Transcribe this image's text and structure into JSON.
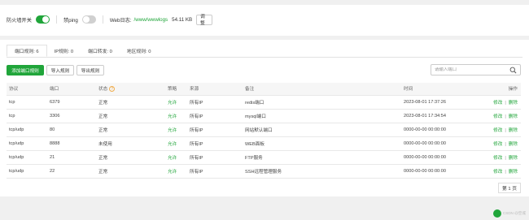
{
  "firewall_bar": {
    "firewall_label": "防火墙开关",
    "firewall_on": true,
    "ping_label": "禁ping",
    "ping_on": false,
    "weblog_label": "Web日志:",
    "weblog_path": "/www/wwwlogs",
    "weblog_size": "54.11 KB",
    "adjust_button": "调整"
  },
  "tabs": [
    {
      "label": "端口规则: 6",
      "active": true
    },
    {
      "label": "IP规则: 0",
      "active": false
    },
    {
      "label": "端口转发: 0",
      "active": false
    },
    {
      "label": "地区规则: 0",
      "active": false
    }
  ],
  "actions": {
    "add_rule": "添加端口规则",
    "import_rule": "导入规则",
    "export_rule": "导出规则"
  },
  "search": {
    "placeholder": "请输入端口",
    "icon": "search-icon"
  },
  "table": {
    "headers": {
      "protocol": "协议",
      "port": "端口",
      "status": "状态",
      "strategy": "策略",
      "source": "来源",
      "remark": "备注",
      "time": "时间",
      "ops": "操作"
    },
    "rows": [
      {
        "protocol": "tcp",
        "port": "6379",
        "status": "正常",
        "strategy": "允许",
        "source": "所有IP",
        "remark": "redis端口",
        "time": "2023-08-01 17:37:26",
        "edit": "修改",
        "delete": "删除"
      },
      {
        "protocol": "tcp",
        "port": "3306",
        "status": "正常",
        "strategy": "允许",
        "source": "所有IP",
        "remark": "mysql端口",
        "time": "2023-08-01 17:34:54",
        "edit": "修改",
        "delete": "删除"
      },
      {
        "protocol": "tcp/udp",
        "port": "80",
        "status": "正常",
        "strategy": "允许",
        "source": "所有IP",
        "remark": "网站默认端口",
        "time": "0000-00-00 00:00:00",
        "edit": "修改",
        "delete": "删除"
      },
      {
        "protocol": "tcp/udp",
        "port": "8888",
        "status": "未使用",
        "strategy": "允许",
        "source": "所有IP",
        "remark": "WEB面板",
        "time": "0000-00-00 00:00:00",
        "edit": "修改",
        "delete": "删除"
      },
      {
        "protocol": "tcp/udp",
        "port": "21",
        "status": "正常",
        "strategy": "允许",
        "source": "所有IP",
        "remark": "FTP服务",
        "time": "0000-00-00 00:00:00",
        "edit": "修改",
        "delete": "删除"
      },
      {
        "protocol": "tcp/udp",
        "port": "22",
        "status": "正常",
        "strategy": "允许",
        "source": "所有IP",
        "remark": "SSH远程管理服务",
        "time": "0000-00-00 00:00:00",
        "edit": "修改",
        "delete": "删除"
      }
    ]
  },
  "pager": {
    "label": "第 1 页"
  },
  "watermark": "CSDN @空城",
  "colors": {
    "accent": "#20a53a",
    "warning": "#f0ad4e"
  }
}
